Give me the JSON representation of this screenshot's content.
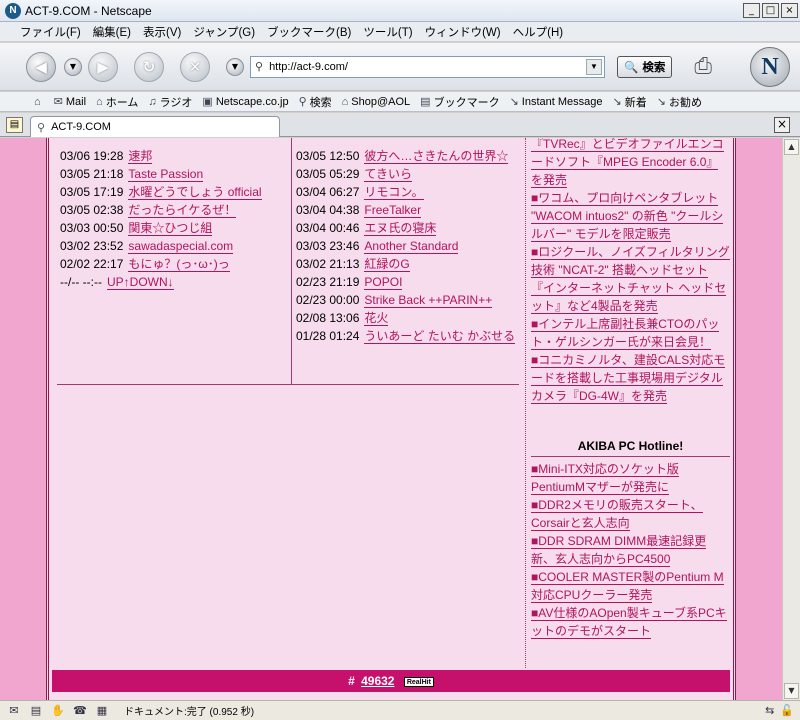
{
  "window": {
    "title": "ACT-9.COM - Netscape",
    "controls": [
      "_",
      "□",
      "×"
    ]
  },
  "menu": [
    "ファイル(F)",
    "編集(E)",
    "表示(V)",
    "ジャンプ(G)",
    "ブックマーク(B)",
    "ツール(T)",
    "ウィンドウ(W)",
    "ヘルプ(H)"
  ],
  "toolbar": {
    "url": "http://act-9.com/",
    "search_label": "検索",
    "logo": "N"
  },
  "bookmarks": [
    {
      "icon": "home-menu-icon",
      "label": ""
    },
    {
      "icon": "mail-icon",
      "label": "Mail"
    },
    {
      "icon": "home-icon",
      "label": "ホーム"
    },
    {
      "icon": "radio-icon",
      "label": "ラジオ"
    },
    {
      "icon": "my-icon",
      "label": "Netscape.co.jp"
    },
    {
      "icon": "search-icon",
      "label": "検索"
    },
    {
      "icon": "shop-icon",
      "label": "Shop@AOL"
    },
    {
      "icon": "folder-icon",
      "label": "ブックマーク"
    },
    {
      "icon": "bookmark-icon",
      "label": "Instant Message"
    },
    {
      "icon": "bookmark-icon",
      "label": "新着"
    },
    {
      "icon": "bookmark-icon",
      "label": "お勧め"
    }
  ],
  "tab": {
    "title": "ACT-9.COM"
  },
  "col1": [
    {
      "time": "03/06 19:28",
      "link": "速邦"
    },
    {
      "time": "03/05 21:18",
      "link": "Taste Passion"
    },
    {
      "time": "03/05 17:19",
      "link": "水曜どうでしょう official"
    },
    {
      "time": "03/05 02:38",
      "link": "だったらイケるぜ！"
    },
    {
      "time": "03/03 00:50",
      "link": "関東☆ひつじ組"
    },
    {
      "time": "03/02 23:52",
      "link": "sawadaspecial.com"
    },
    {
      "time": "02/02 22:17",
      "link": "もにゅ？(っ･ω･)っ"
    },
    {
      "time": "--/-- --:--",
      "link": "UP↑DOWN↓"
    }
  ],
  "col2": [
    {
      "time": "03/05 12:50",
      "link": "彼方へ…さきたんの世界☆"
    },
    {
      "time": "03/05 05:29",
      "link": "てきいら"
    },
    {
      "time": "03/04 06:27",
      "link": "リモコン。"
    },
    {
      "time": "03/04 04:38",
      "link": "FreeTalker"
    },
    {
      "time": "03/04 00:46",
      "link": "エヌ氏の寝床"
    },
    {
      "time": "03/03 23:46",
      "link": "Another Standard"
    },
    {
      "time": "03/02 21:13",
      "link": "紅緑のG"
    },
    {
      "time": "02/23 21:19",
      "link": "POPOI"
    },
    {
      "time": "02/23 00:00",
      "link": "Strike Back ++PARIN++"
    },
    {
      "time": "02/08 13:06",
      "link": "花火"
    },
    {
      "time": "01/28 01:24",
      "link": "ういあーど たいむ かぶせる"
    }
  ],
  "news_top": [
    "『TVRec』とビデオファイルエンコードソフト『MPEG Encoder 6.0』を発売",
    "■ワコム、プロ向けペンタブレット \"WACOM intuos2\" の新色 \"クールシルバー\" モデルを限定販売",
    "■ロジクール、ノイズフィルタリング技術 \"NCAT-2\" 搭載ヘッドセット『インターネットチャット ヘッドセット』など4製品を発売",
    "■インテル上席副社長兼CTOのパット・ゲルシンガー氏が来日会見！",
    "■コニカミノルタ、建設CALS対応モードを搭載した工事現場用デジタルカメラ『DG-4W』を発売"
  ],
  "hotline": {
    "title": "AKIBA PC Hotline!",
    "items": [
      "■Mini-ITX対応のソケット版PentiumMマザーが発売に",
      "■DDR2メモリの販売スタート、Corsairと玄人志向",
      "■DDR SDRAM DIMM最速記録更新、玄人志向からPC4500",
      "■COOLER MASTER製のPentium M対応CPUクーラー発売",
      "■AV仕様のAOpen製キューブ系PCキットのデモがスタート"
    ]
  },
  "footer": {
    "prefix": "#",
    "counter": "49632",
    "badge": "RealHit"
  },
  "status": {
    "message": "ドキュメント:完了 (0.952 秒)"
  }
}
